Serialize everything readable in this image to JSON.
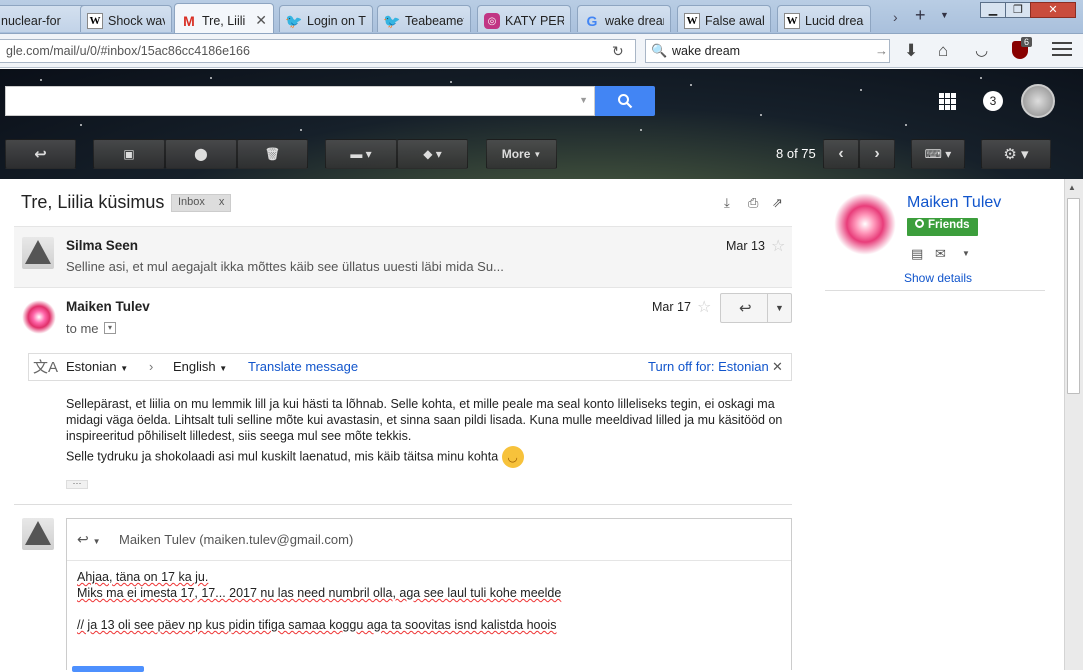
{
  "browser": {
    "tabs": [
      {
        "label": "nuclear-for",
        "icon": "blank-page-icon"
      },
      {
        "label": "Shock wave",
        "icon": "wikipedia-icon"
      },
      {
        "label": "Tre, Liili",
        "icon": "gmail-icon"
      },
      {
        "label": "Login on T",
        "icon": "twitter-icon"
      },
      {
        "label": "Teabeamet",
        "icon": "twitter-icon"
      },
      {
        "label": "KATY PERR",
        "icon": "instagram-icon"
      },
      {
        "label": "wake dream",
        "icon": "google-icon"
      },
      {
        "label": "False awak",
        "icon": "wikipedia-icon"
      },
      {
        "label": "Lucid drear",
        "icon": "wikipedia-icon"
      }
    ],
    "url": "gle.com/mail/u/0/#inbox/15ac86cc4186e166",
    "search_value": "wake dream",
    "addon_badge": "6"
  },
  "gmail": {
    "notification_count": "3",
    "search_placeholder": "",
    "toolbar": {
      "more_label": "More",
      "pager": "8 of 75"
    },
    "thread": {
      "subject": "Tre, Liilia küsimus",
      "label": "Inbox",
      "label_remove": "x"
    },
    "messages": [
      {
        "sender": "Silma Seen",
        "snippet": "Selline asi, et mul aegajalt ikka mõttes käib see üllatus uuesti läbi mida Su...",
        "date": "Mar 13"
      },
      {
        "sender": "Maiken Tulev",
        "to": "to me",
        "date": "Mar 17",
        "body": [
          "Sellepärast, et liilia on mu lemmik lill ja kui hästi ta lõhnab. Selle kohta, et mille peale ma seal konto lilleliseks tegin, ei oskagi ma midagi väga öelda. Lihtsalt tuli selline mõte kui avastasin, et sinna saan pildi lisada. Kuna mulle meeldivad lilled ja mu käsitööd on inspireeritud põhiliselt lilledest, siis seega mul see mõte tekkis.",
          "Selle tydruku ja shokolaadi asi mul kuskilt laenatud, mis käib täitsa minu kohta"
        ],
        "ellipsis": "···"
      }
    ],
    "translate": {
      "from": "Estonian",
      "to": "English",
      "action": "Translate message",
      "turn_off": "Turn off for: Estonian"
    },
    "compose": {
      "recipient": "Maiken Tulev (maiken.tulev@gmail.com)",
      "lines": [
        "Ahjaa, täna on 17 ka ju.",
        "Miks ma ei imesta 17, 17... 2017 nu las need numbril olla, aga see laul tuli kohe meelde",
        "",
        "// ja 13 oli see päev np  kus pidin tifiga samaa koggu aga ta soovitas isnd kalistda hoois"
      ]
    },
    "contact": {
      "name": "Maiken Tulev",
      "circle": "Friends",
      "show_details": "Show details"
    }
  },
  "colors": {
    "gmail_blue": "#4285f4",
    "link": "#1155cc",
    "friends_green": "#3c9e3c"
  }
}
